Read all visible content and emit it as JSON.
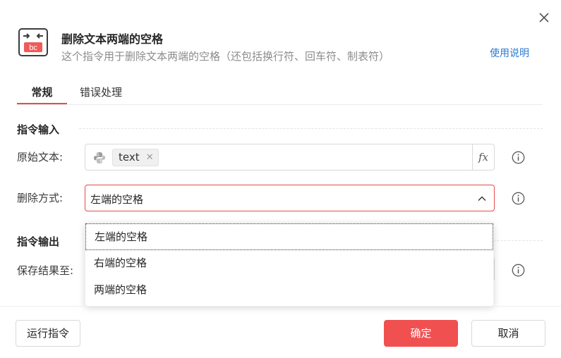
{
  "dialog": {
    "title": "删除文本两端的空格",
    "subtitle": "这个指令用于删除文本两端的空格（还包括换行符、回车符、制表符）",
    "help_link": "使用说明",
    "icon_text": "bc"
  },
  "tabs": [
    {
      "label": "常规",
      "active": true
    },
    {
      "label": "错误处理",
      "active": false
    }
  ],
  "input_section": {
    "title": "指令输入",
    "fields": {
      "source_text": {
        "label": "原始文本:",
        "tag": "text",
        "fx_label": "fx"
      },
      "delete_mode": {
        "label": "删除方式:",
        "value": "左端的空格"
      }
    }
  },
  "output_section": {
    "title": "指令输出",
    "fields": {
      "save_to": {
        "label": "保存结果至:"
      }
    }
  },
  "dropdown": {
    "options": [
      "左端的空格",
      "右端的空格",
      "两端的空格"
    ],
    "focused_index": 0
  },
  "footer": {
    "run_label": "运行指令",
    "ok_label": "确定",
    "cancel_label": "取消"
  },
  "colors": {
    "accent": "#f05050",
    "link": "#2b7ad1",
    "tab_underline": "#e84a4a"
  },
  "icons": [
    "close-icon",
    "trim-text-icon",
    "python-icon",
    "tag-close-icon",
    "info-icon",
    "chevron-up-icon"
  ]
}
